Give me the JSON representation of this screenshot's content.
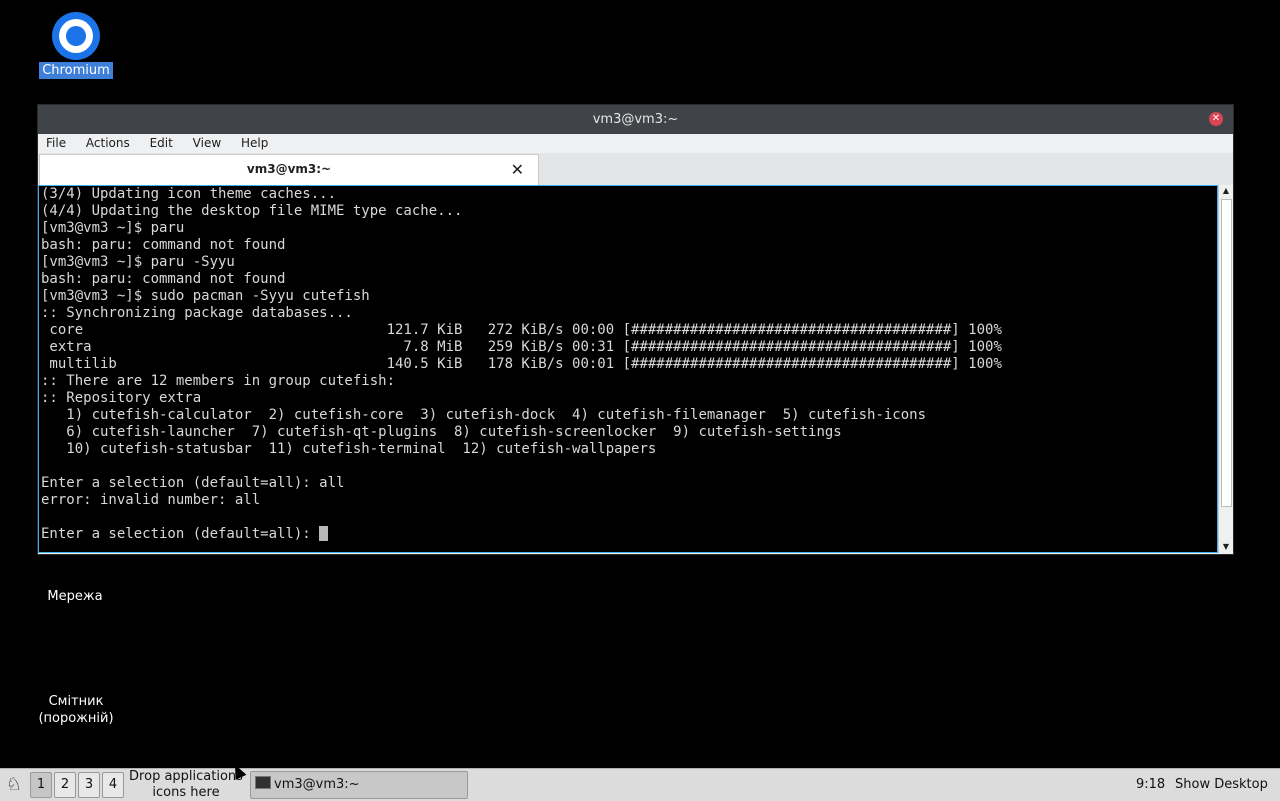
{
  "desktop": {
    "icons": {
      "chromium": "Chromium",
      "network": "Мережа",
      "trash_line1": "Смітник",
      "trash_line2": "(порожній)"
    }
  },
  "window": {
    "title": "vm3@vm3:~",
    "menu": [
      "File",
      "Actions",
      "Edit",
      "View",
      "Help"
    ],
    "tab_title": "vm3@vm3:~",
    "tab_close_glyph": "✕"
  },
  "terminal": {
    "lines": [
      "(3/4) Updating icon theme caches...",
      "(4/4) Updating the desktop file MIME type cache...",
      "[vm3@vm3 ~]$ paru",
      "bash: paru: command not found",
      "[vm3@vm3 ~]$ paru -Syyu",
      "bash: paru: command not found",
      "[vm3@vm3 ~]$ sudo pacman -Syyu cutefish",
      ":: Synchronizing package databases...",
      " core                                    121.7 KiB   272 KiB/s 00:00 [######################################] 100%",
      " extra                                     7.8 MiB   259 KiB/s 00:31 [######################################] 100%",
      " multilib                                140.5 KiB   178 KiB/s 00:01 [######################################] 100%",
      ":: There are 12 members in group cutefish:",
      ":: Repository extra",
      "   1) cutefish-calculator  2) cutefish-core  3) cutefish-dock  4) cutefish-filemanager  5) cutefish-icons",
      "   6) cutefish-launcher  7) cutefish-qt-plugins  8) cutefish-screenlocker  9) cutefish-settings",
      "   10) cutefish-statusbar  11) cutefish-terminal  12) cutefish-wallpapers",
      "",
      "Enter a selection (default=all): all",
      "error: invalid number: all",
      ""
    ],
    "prompt": "Enter a selection (default=all): "
  },
  "taskbar": {
    "desktops": [
      "1",
      "2",
      "3",
      "4"
    ],
    "active_desktop": "1",
    "drop_zone_line1": "Drop applications",
    "drop_zone_line2": "icons here",
    "task_label": "vm3@vm3:~",
    "clock": "9:18",
    "show_desktop": "Show Desktop"
  },
  "colors": {
    "desktop_bg": "#000000",
    "selection": "#3d7fd9",
    "titlebar": "#404448",
    "focus_border": "#3daee9",
    "close": "#da4453"
  }
}
